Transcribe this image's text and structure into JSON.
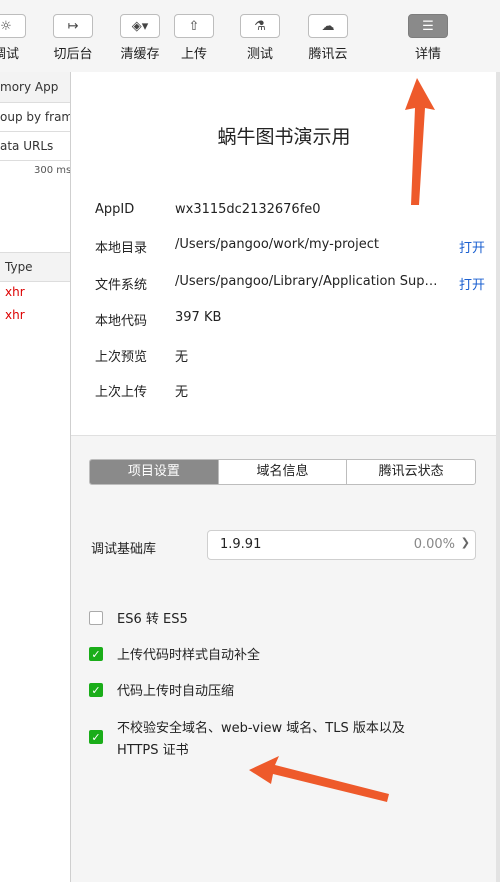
{
  "toolbar": {
    "buttons": [
      {
        "label": "调试",
        "icon": "bug-icon",
        "glyph": "☼"
      },
      {
        "label": "切后台",
        "icon": "switch-background-icon",
        "glyph": "↦"
      },
      {
        "label": "清缓存",
        "icon": "clear-cache-icon",
        "glyph": "◈▾"
      },
      {
        "label": "上传",
        "icon": "upload-icon",
        "glyph": "⇧"
      },
      {
        "label": "测试",
        "icon": "flask-icon",
        "glyph": "⚗"
      },
      {
        "label": "腾讯云",
        "icon": "cloud-icon",
        "glyph": "☁"
      },
      {
        "label": "详情",
        "icon": "menu-icon",
        "glyph": "☰"
      }
    ]
  },
  "devtools": {
    "tabs": "mory   App",
    "filter": "oup by fram",
    "data_urls": "ata URLs",
    "timing": "300 ms",
    "type_header": "Type",
    "rows": [
      "xhr",
      "xhr"
    ]
  },
  "project": {
    "title": "蜗牛图书演示用",
    "info": [
      {
        "key": "AppID",
        "value": "wx3115dc2132676fe0",
        "action": ""
      },
      {
        "key": "本地目录",
        "value": "/Users/pangoo/work/my-project",
        "action": "打开"
      },
      {
        "key": "文件系统",
        "value": "/Users/pangoo/Library/Application Supp...",
        "action": "打开"
      },
      {
        "key": "本地代码",
        "value": "397 KB",
        "action": ""
      },
      {
        "key": "上次预览",
        "value": "无",
        "action": ""
      },
      {
        "key": "上次上传",
        "value": "无",
        "action": ""
      }
    ]
  },
  "tabs": {
    "items": [
      "项目设置",
      "域名信息",
      "腾讯云状态"
    ],
    "selected": 0
  },
  "library": {
    "label": "调试基础库",
    "version": "1.9.91",
    "percent": "0.00%"
  },
  "settings": [
    {
      "label": "ES6 转 ES5",
      "checked": false
    },
    {
      "label": "上传代码时样式自动补全",
      "checked": true
    },
    {
      "label": "代码上传时自动压缩",
      "checked": true
    },
    {
      "label": "不校验安全域名、web-view 域名、TLS 版本以及 HTTPS 证书",
      "checked": true
    }
  ],
  "colors": {
    "accent_link": "#1a5fd0",
    "check_green": "#1aad19",
    "annotation_arrow": "#ee5a2b",
    "selected_gray": "#8a8a8a"
  }
}
